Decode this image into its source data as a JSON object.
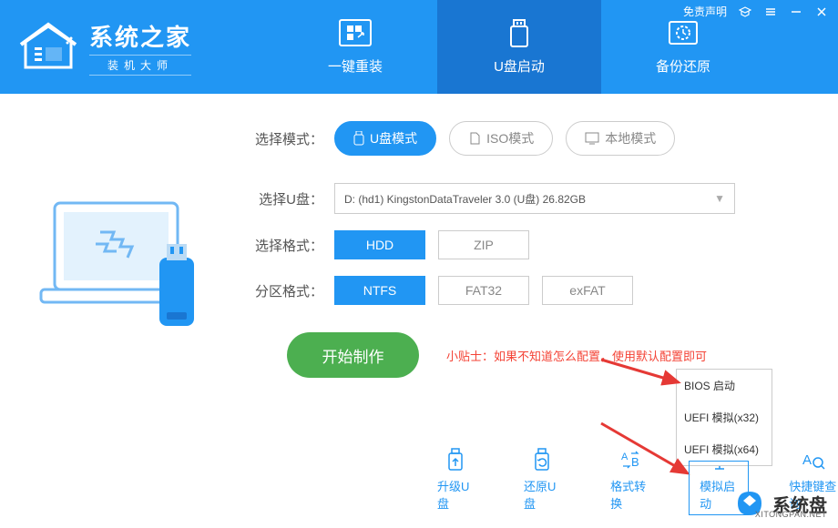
{
  "header": {
    "logo_title": "系统之家",
    "logo_sub": "装机大师",
    "tabs": [
      {
        "label": "一键重装"
      },
      {
        "label": "U盘启动"
      },
      {
        "label": "备份还原"
      }
    ]
  },
  "titlebar": {
    "disclaimer": "免责声明"
  },
  "form": {
    "mode_label": "选择模式：",
    "modes": [
      {
        "label": "U盘模式"
      },
      {
        "label": "ISO模式"
      },
      {
        "label": "本地模式"
      }
    ],
    "usb_label": "选择U盘：",
    "usb_value": "D: (hd1) KingstonDataTraveler 3.0 (U盘) 26.82GB",
    "format_label": "选择格式：",
    "formats": [
      "HDD",
      "ZIP"
    ],
    "partition_label": "分区格式：",
    "partitions": [
      "NTFS",
      "FAT32",
      "exFAT"
    ],
    "start_button": "开始制作",
    "tip": "小贴士：如果不知道怎么配置，使用默认配置即可"
  },
  "tools": [
    {
      "label": "升级U盘"
    },
    {
      "label": "还原U盘"
    },
    {
      "label": "格式转换"
    },
    {
      "label": "模拟启动"
    },
    {
      "label": "快捷键查询"
    }
  ],
  "dropdown": [
    "BIOS 启动",
    "UEFI 模拟(x32)",
    "UEFI 模拟(x64)"
  ],
  "watermark": {
    "brand": "系统盘",
    "url": "XITONGPAN.NET"
  }
}
